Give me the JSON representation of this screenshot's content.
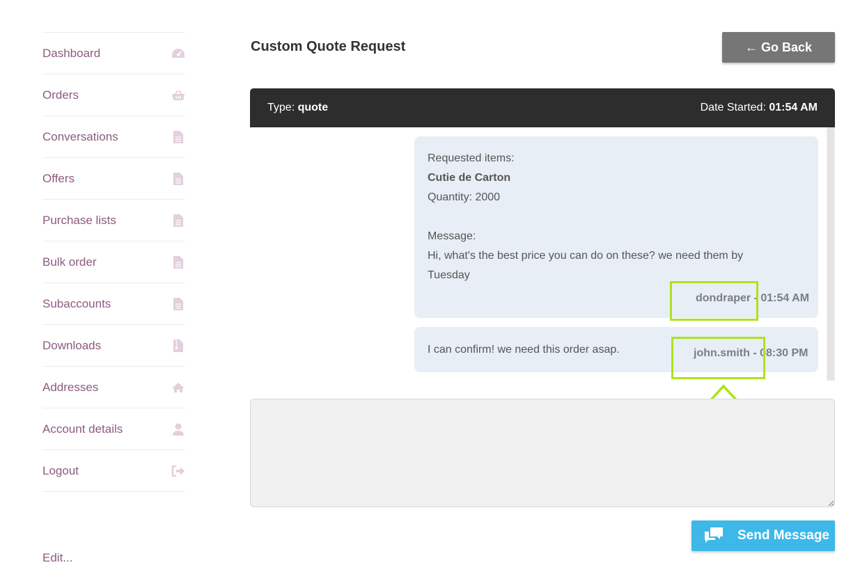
{
  "sidebar": {
    "items": [
      {
        "label": "Dashboard",
        "icon": "dashboard-icon"
      },
      {
        "label": "Orders",
        "icon": "basket-icon"
      },
      {
        "label": "Conversations",
        "icon": "document-icon"
      },
      {
        "label": "Offers",
        "icon": "document-icon"
      },
      {
        "label": "Purchase lists",
        "icon": "document-icon"
      },
      {
        "label": "Bulk order",
        "icon": "document-icon"
      },
      {
        "label": "Subaccounts",
        "icon": "document-icon"
      },
      {
        "label": "Downloads",
        "icon": "archive-file-icon"
      },
      {
        "label": "Addresses",
        "icon": "home-icon"
      },
      {
        "label": "Account details",
        "icon": "user-icon"
      },
      {
        "label": "Logout",
        "icon": "sign-out-icon"
      }
    ],
    "cut_off_label": "Edit..."
  },
  "header": {
    "title": "Custom Quote Request",
    "go_back_label": "← Go Back"
  },
  "conversation": {
    "type_label": "Type:",
    "type_value": "quote",
    "date_label": "Date Started:",
    "date_value": "01:54 AM",
    "messages": [
      {
        "requested_label": "Requested items:",
        "item_name": "Cutie de Carton",
        "quantity": "Quantity: 2000",
        "message_label": "Message:",
        "text_line1": "Hi, what's the best price you can do on these? we need them by",
        "text_line2": "Tuesday",
        "author": "dondraper",
        "separator": "-",
        "time": "01:54 AM"
      },
      {
        "text": "I can confirm! we need this order asap.",
        "author": "john.smith",
        "separator": "-",
        "time": "08:30 PM"
      }
    ]
  },
  "composer": {
    "placeholder": "",
    "send_label": "Send Message"
  },
  "colors": {
    "accent_purple": "#8c5a82",
    "header_dark": "#2d2d2d",
    "bubble_bg": "#e8eef5",
    "send_blue": "#3eb8e8",
    "highlight_green": "#aee21f"
  }
}
